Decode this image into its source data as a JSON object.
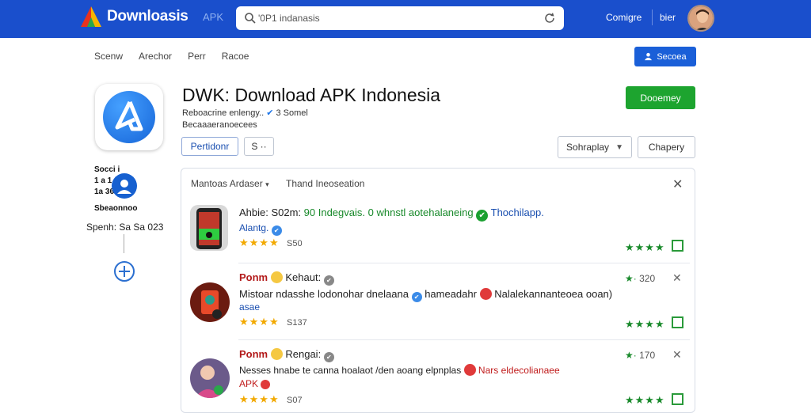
{
  "topbar": {
    "brand": "Downloasis",
    "apk_tab": "APK",
    "search_value": "'0P1 indanasis",
    "link1": "Comigre",
    "link2": "bier"
  },
  "subnav": {
    "items": [
      "Scenw",
      "Arechor",
      "Perr",
      "Racoe"
    ],
    "primary_button": "Secoea"
  },
  "app": {
    "title": "DWK: Download APK Indonesia",
    "subtitle": "Reboacrine enlengy..",
    "verified": "3 Somel",
    "meta": "Becaaaeranoecees",
    "download_button": "Dooemey",
    "btn_outline": "Pertidonr",
    "btn_small": "S ··",
    "sort_button": "Sohraplay",
    "category_button": "Chapery"
  },
  "side": {
    "line1": "Socci i",
    "line2": "1 a   1",
    "line3": "1a  369",
    "line4": "Sbeaonnoo",
    "label": "Spenh: Sa Sa 023"
  },
  "panel": {
    "head1": "Mantoas Ardaser",
    "head2": "Thand Ineoseation",
    "rows": [
      {
        "title_a": "Ahbie: S02m: ",
        "title_b": "90 Indegvais.",
        "title_c": "0 whnstl aotehalaneing",
        "title_d": "Thochilapp.",
        "link": "Alantg.",
        "stars": "★★★★",
        "count": "S50"
      },
      {
        "title_a": "Ponm",
        "title_b": "Kehaut:",
        "line": "Mistoar ndasshe lodonohar dnelaana",
        "line_b": "hameadahr",
        "line_c": "Nalalekannanteoea ooan)",
        "link": "asae",
        "stars": "★★★★",
        "count": "S137",
        "vote": "320"
      },
      {
        "title_a": "Ponm",
        "title_b": "Rengai:",
        "line": "Nesses hnabe te canna hoalaot /den aoang elpnplas",
        "line_b": "Nars eldecolianaee",
        "link": "APK",
        "stars": "★★★★",
        "count": "S07",
        "vote": "170"
      }
    ]
  },
  "colors": {
    "topbar": "#1a4fcc",
    "primary": "#1a5fd8",
    "download": "#1da42f",
    "star": "#f2a900",
    "green": "#1a8a2c"
  }
}
